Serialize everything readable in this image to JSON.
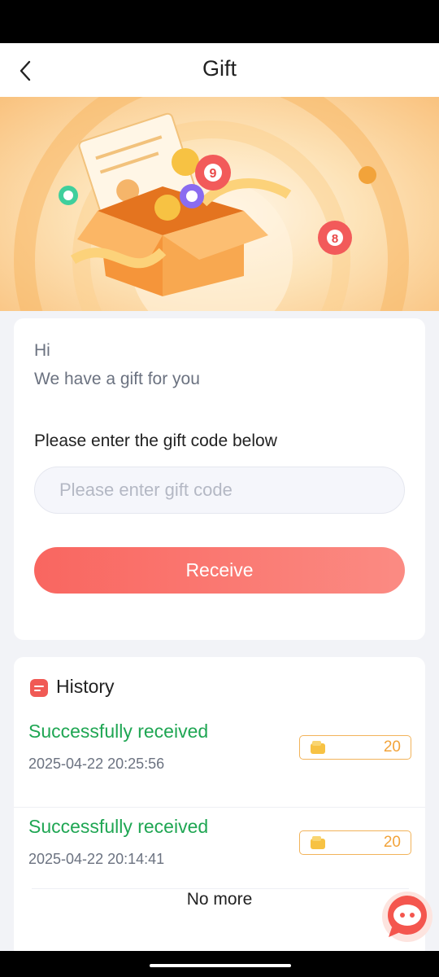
{
  "header": {
    "title": "Gift"
  },
  "gift_form": {
    "greeting": "Hi",
    "subtitle": "We have a gift for you",
    "prompt": "Please enter the gift code below",
    "code_input": {
      "placeholder": "Please enter gift code",
      "value": ""
    },
    "receive_label": "Receive"
  },
  "history": {
    "title": "History",
    "records": [
      {
        "status": "Successfully received",
        "time": "2025-04-22 20:25:56",
        "amount": "20"
      },
      {
        "status": "Successfully received",
        "time": "2025-04-22 20:14:41",
        "amount": "20"
      }
    ],
    "end_label": "No more"
  },
  "colors": {
    "accent": "#f96660",
    "success": "#1fa653",
    "amount": "#f2a33a",
    "banner": "#f9c27e"
  },
  "icons": [
    "back-arrow-icon",
    "history-icon",
    "wallet-icon",
    "support-chat-icon"
  ]
}
